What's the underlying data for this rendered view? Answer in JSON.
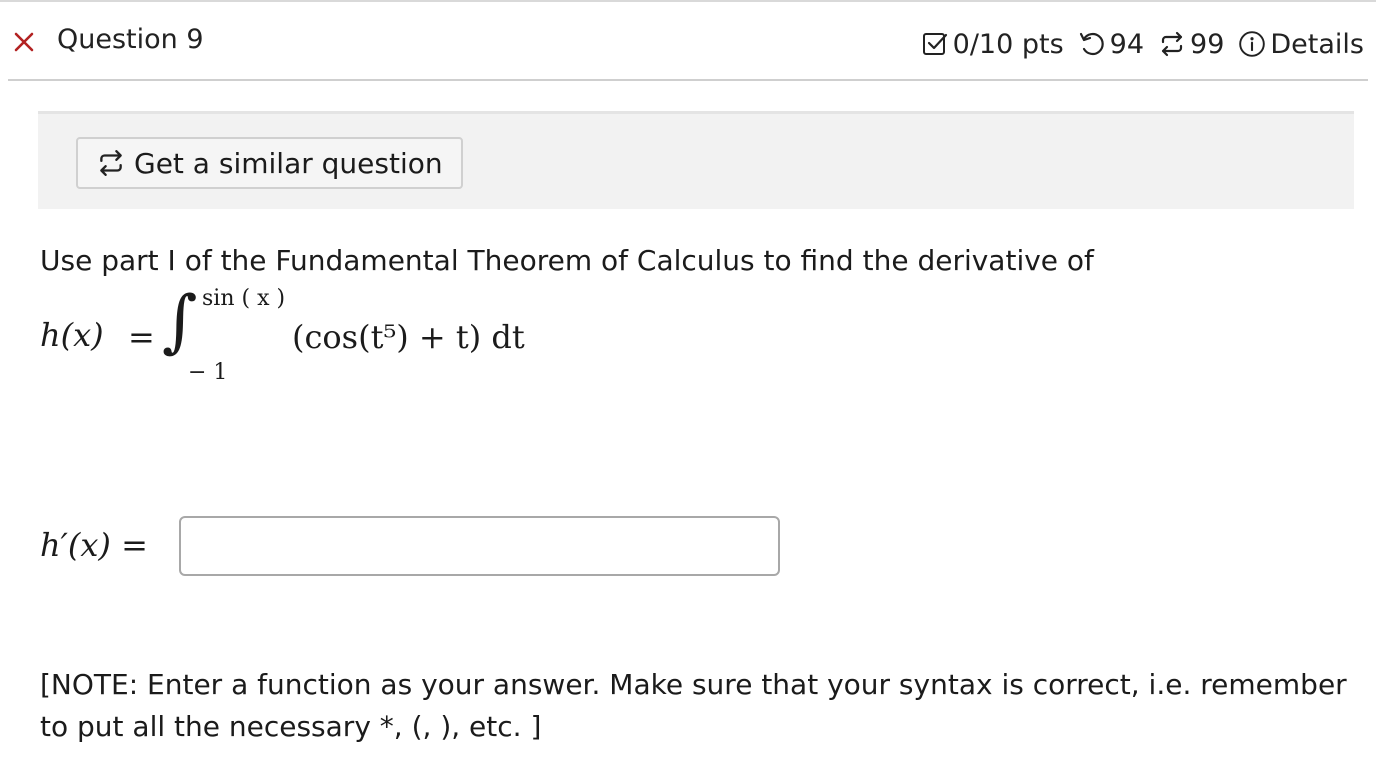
{
  "header": {
    "status_icon": "x-mark-icon",
    "status_color": "#b22222",
    "title": "Question 9",
    "score": "0/10 pts",
    "attempts": "94",
    "versions": "99",
    "details_label": "Details"
  },
  "toolbar": {
    "similar_label": "Get a similar question"
  },
  "question": {
    "prompt": "Use part I of the Fundamental Theorem of Calculus to find the derivative of",
    "lhs": "h(x)",
    "equals": "=",
    "integral_sign": "∫",
    "upper_limit": "sin ( x )",
    "lower_limit": "− 1",
    "integrand": "(cos(t⁵) + t) dt",
    "answer_label": "h′(x) =",
    "answer_value": "",
    "note": "[NOTE: Enter a function as your answer. Make sure that your syntax is correct, i.e. remember to put all the necessary *, (, ), etc. ]"
  }
}
